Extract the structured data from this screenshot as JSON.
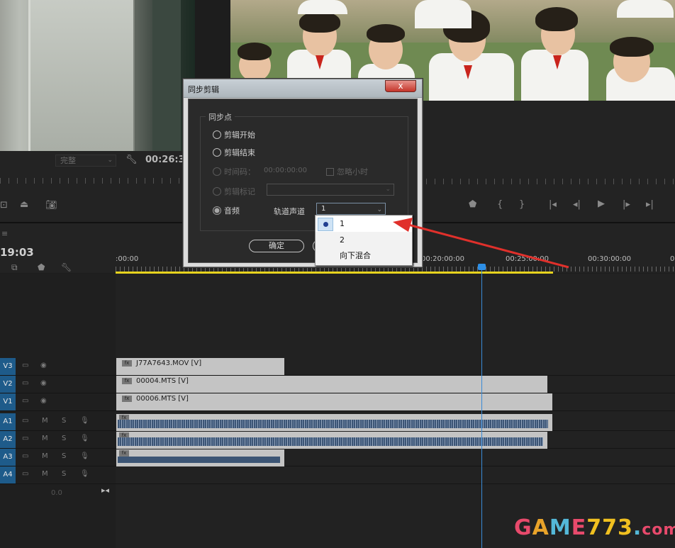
{
  "source_monitor": {
    "fit_dropdown": "完整",
    "timecode": "00:26:3"
  },
  "timeline": {
    "timecode": "19:03",
    "ruler_ticks": [
      ":00:00",
      "00:20:00:00",
      "00:25:00:00",
      "00:30:00:00",
      "00"
    ],
    "volume_value": "0.0",
    "tracks": [
      {
        "label": "V3",
        "type": "video"
      },
      {
        "label": "V2",
        "type": "video"
      },
      {
        "label": "V1",
        "type": "video"
      },
      {
        "label": "A1",
        "type": "audio"
      },
      {
        "label": "A2",
        "type": "audio"
      },
      {
        "label": "A3",
        "type": "audio"
      },
      {
        "label": "A4",
        "type": "audio"
      }
    ],
    "clips": {
      "v3": "J77A7643.MOV [V]",
      "v2": "00004.MTS [V]",
      "v1": "00006.MTS [V]"
    },
    "fx_badge": "fx",
    "mute_letter": "M",
    "solo_letter": "S"
  },
  "dialog": {
    "title": "同步剪辑",
    "close_symbol": "x",
    "group_label": "同步点",
    "options": {
      "clip_start": "剪辑开始",
      "clip_end": "剪辑结束",
      "timecode": "时间码：",
      "timecode_value": "00:00:00:00",
      "ignore_hours": "忽略小时",
      "clip_marker": "剪辑标记",
      "audio": "音频",
      "track_channel_label": "轨道声道",
      "track_channel_value": "1"
    },
    "ok_label": "确定"
  },
  "dropdown": {
    "items": [
      "1",
      "2",
      "向下混合"
    ],
    "selected_index": 0
  },
  "colors": {
    "arrow": "#e0302b",
    "track_label": "#1e5b8a",
    "playhead": "#3a8bd6"
  },
  "watermark": {
    "g": "G",
    "a": "A",
    "m": "M",
    "e": "E",
    "num": "773",
    "dot": ".",
    "com": "com"
  }
}
